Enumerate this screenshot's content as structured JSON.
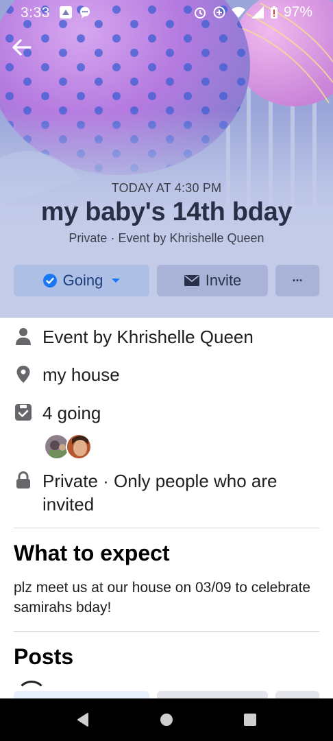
{
  "status_bar": {
    "time": "3:33",
    "battery_percent": "97%",
    "left_icons": [
      "photos-icon",
      "chat-icon"
    ],
    "right_icons": [
      "alarm-icon",
      "data-saver-icon",
      "wifi-icon",
      "signal-icon",
      "battery-icon"
    ]
  },
  "header": {
    "back_icon": "arrow-left-icon",
    "event_time": "TODAY AT 4:30 PM",
    "event_title": "my baby's 14th bday",
    "event_subtitle": "Private · Event by Khrishelle Queen"
  },
  "actions": {
    "going_label": "Going",
    "invite_label": "Invite",
    "more_label": "···"
  },
  "details": {
    "host": "Event by Khrishelle Queen",
    "location": "my house",
    "going_count": "4 going",
    "privacy": "Private · Only people who are invited"
  },
  "about": {
    "title": "What to expect",
    "description": "plz meet us at our house on 03/09 to celebrate samirahs bday!"
  },
  "posts": {
    "title": "Posts"
  },
  "navigation": [
    "back-triangle-icon",
    "home-circle-icon",
    "recents-square-icon"
  ],
  "colors": {
    "header_bg": "#c3cbe9",
    "going_button": "#aebfe6",
    "secondary_button": "#a9b3d7",
    "accent_blue": "#1877f2",
    "title_text": "#283047"
  }
}
